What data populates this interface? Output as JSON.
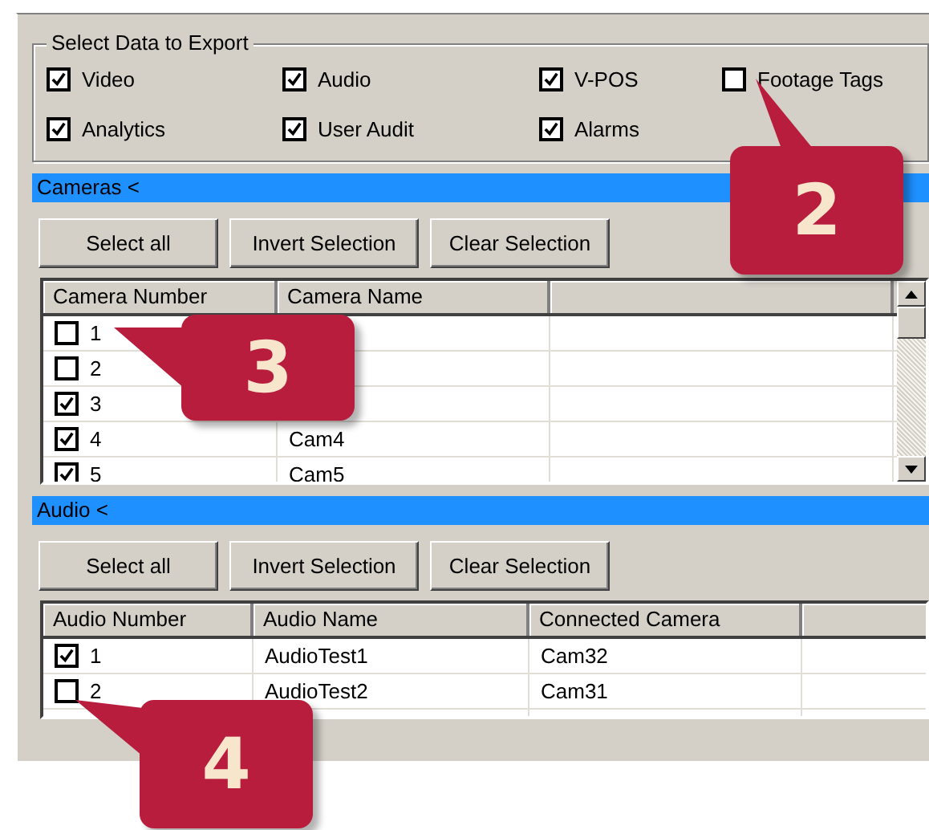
{
  "export_group": {
    "title": "Select Data to Export",
    "options": [
      {
        "label": "Video",
        "checked": true
      },
      {
        "label": "Audio",
        "checked": true
      },
      {
        "label": "V-POS",
        "checked": true
      },
      {
        "label": "Footage Tags",
        "checked": false
      },
      {
        "label": "Analytics",
        "checked": true
      },
      {
        "label": "User Audit",
        "checked": true
      },
      {
        "label": "Alarms",
        "checked": true
      }
    ]
  },
  "sections": [
    {
      "title": "Cameras <",
      "buttons": [
        "Select all",
        "Invert Selection",
        "Clear Selection"
      ],
      "columns": [
        "Camera Number",
        "Camera Name"
      ],
      "scrollbar": true,
      "rows": [
        {
          "checked": false,
          "cells": [
            "1"
          ]
        },
        {
          "checked": false,
          "cells": [
            "2"
          ]
        },
        {
          "checked": true,
          "cells": [
            "3"
          ]
        },
        {
          "checked": true,
          "cells": [
            "4",
            "Cam4"
          ]
        },
        {
          "checked": true,
          "cells": [
            "5",
            "Cam5"
          ]
        }
      ]
    },
    {
      "title": "Audio <",
      "buttons": [
        "Select all",
        "Invert Selection",
        "Clear Selection"
      ],
      "columns": [
        "Audio Number",
        "Audio Name",
        "Connected Camera"
      ],
      "rows": [
        {
          "checked": true,
          "cells": [
            "1",
            "AudioTest1",
            "Cam32"
          ]
        },
        {
          "checked": false,
          "cells": [
            "2",
            "AudioTest2",
            "Cam31"
          ]
        }
      ]
    }
  ],
  "callouts": [
    {
      "label": "2"
    },
    {
      "label": "3"
    },
    {
      "label": "4"
    }
  ]
}
